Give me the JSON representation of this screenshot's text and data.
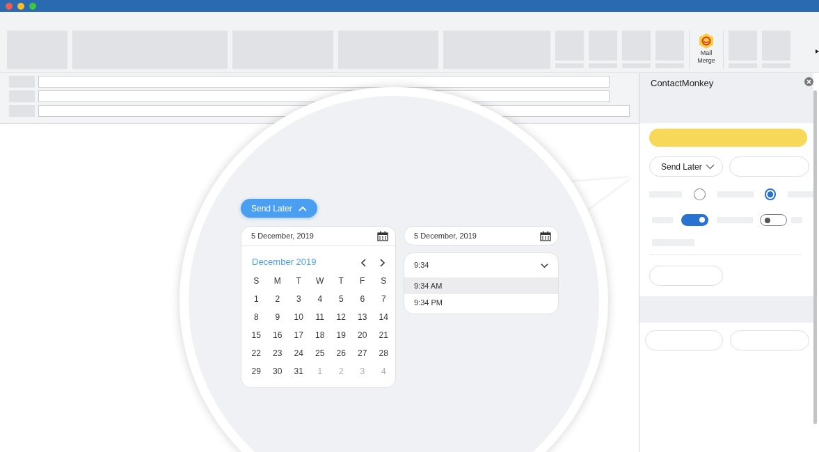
{
  "ribbon": {
    "mail_merge": {
      "label": "Mail Merge"
    }
  },
  "magnifier": {
    "send_later_button": {
      "label": "Send Later",
      "expanded": true
    },
    "calendar": {
      "date_field": "5 December, 2019",
      "month": "December 2019",
      "weekdays": [
        "S",
        "M",
        "T",
        "W",
        "T",
        "F",
        "S"
      ],
      "days": [
        {
          "day": "1",
          "muted": false
        },
        {
          "day": "2",
          "muted": false
        },
        {
          "day": "3",
          "muted": false
        },
        {
          "day": "4",
          "muted": false
        },
        {
          "day": "5",
          "muted": false
        },
        {
          "day": "6",
          "muted": false
        },
        {
          "day": "7",
          "muted": false
        },
        {
          "day": "8",
          "muted": false
        },
        {
          "day": "9",
          "muted": false
        },
        {
          "day": "10",
          "muted": false
        },
        {
          "day": "11",
          "muted": false
        },
        {
          "day": "12",
          "muted": false
        },
        {
          "day": "13",
          "muted": false
        },
        {
          "day": "14",
          "muted": false
        },
        {
          "day": "15",
          "muted": false
        },
        {
          "day": "16",
          "muted": false
        },
        {
          "day": "17",
          "muted": false
        },
        {
          "day": "18",
          "muted": false
        },
        {
          "day": "19",
          "muted": false
        },
        {
          "day": "20",
          "muted": false
        },
        {
          "day": "21",
          "muted": false
        },
        {
          "day": "22",
          "muted": false
        },
        {
          "day": "23",
          "muted": false
        },
        {
          "day": "24",
          "muted": false
        },
        {
          "day": "25",
          "muted": false
        },
        {
          "day": "26",
          "muted": false
        },
        {
          "day": "27",
          "muted": false
        },
        {
          "day": "28",
          "muted": false
        },
        {
          "day": "29",
          "muted": false
        },
        {
          "day": "30",
          "muted": false
        },
        {
          "day": "31",
          "muted": false
        },
        {
          "day": "1",
          "muted": true
        },
        {
          "day": "2",
          "muted": true
        },
        {
          "day": "3",
          "muted": true
        },
        {
          "day": "4",
          "muted": true
        }
      ]
    },
    "date_field": "5 December, 2019",
    "time_dropdown": {
      "value": "9:34",
      "expanded": true,
      "options": [
        {
          "label": "9:34 AM",
          "selected": true
        },
        {
          "label": "9:34 PM",
          "selected": false
        }
      ]
    }
  },
  "side_panel": {
    "title": "ContactMonkey",
    "send_later_dropdown": {
      "label": "Send Later"
    },
    "radios": [
      {
        "selected": false
      },
      {
        "selected": true
      }
    ],
    "toggles": [
      {
        "on": true
      },
      {
        "on": false
      }
    ]
  }
}
